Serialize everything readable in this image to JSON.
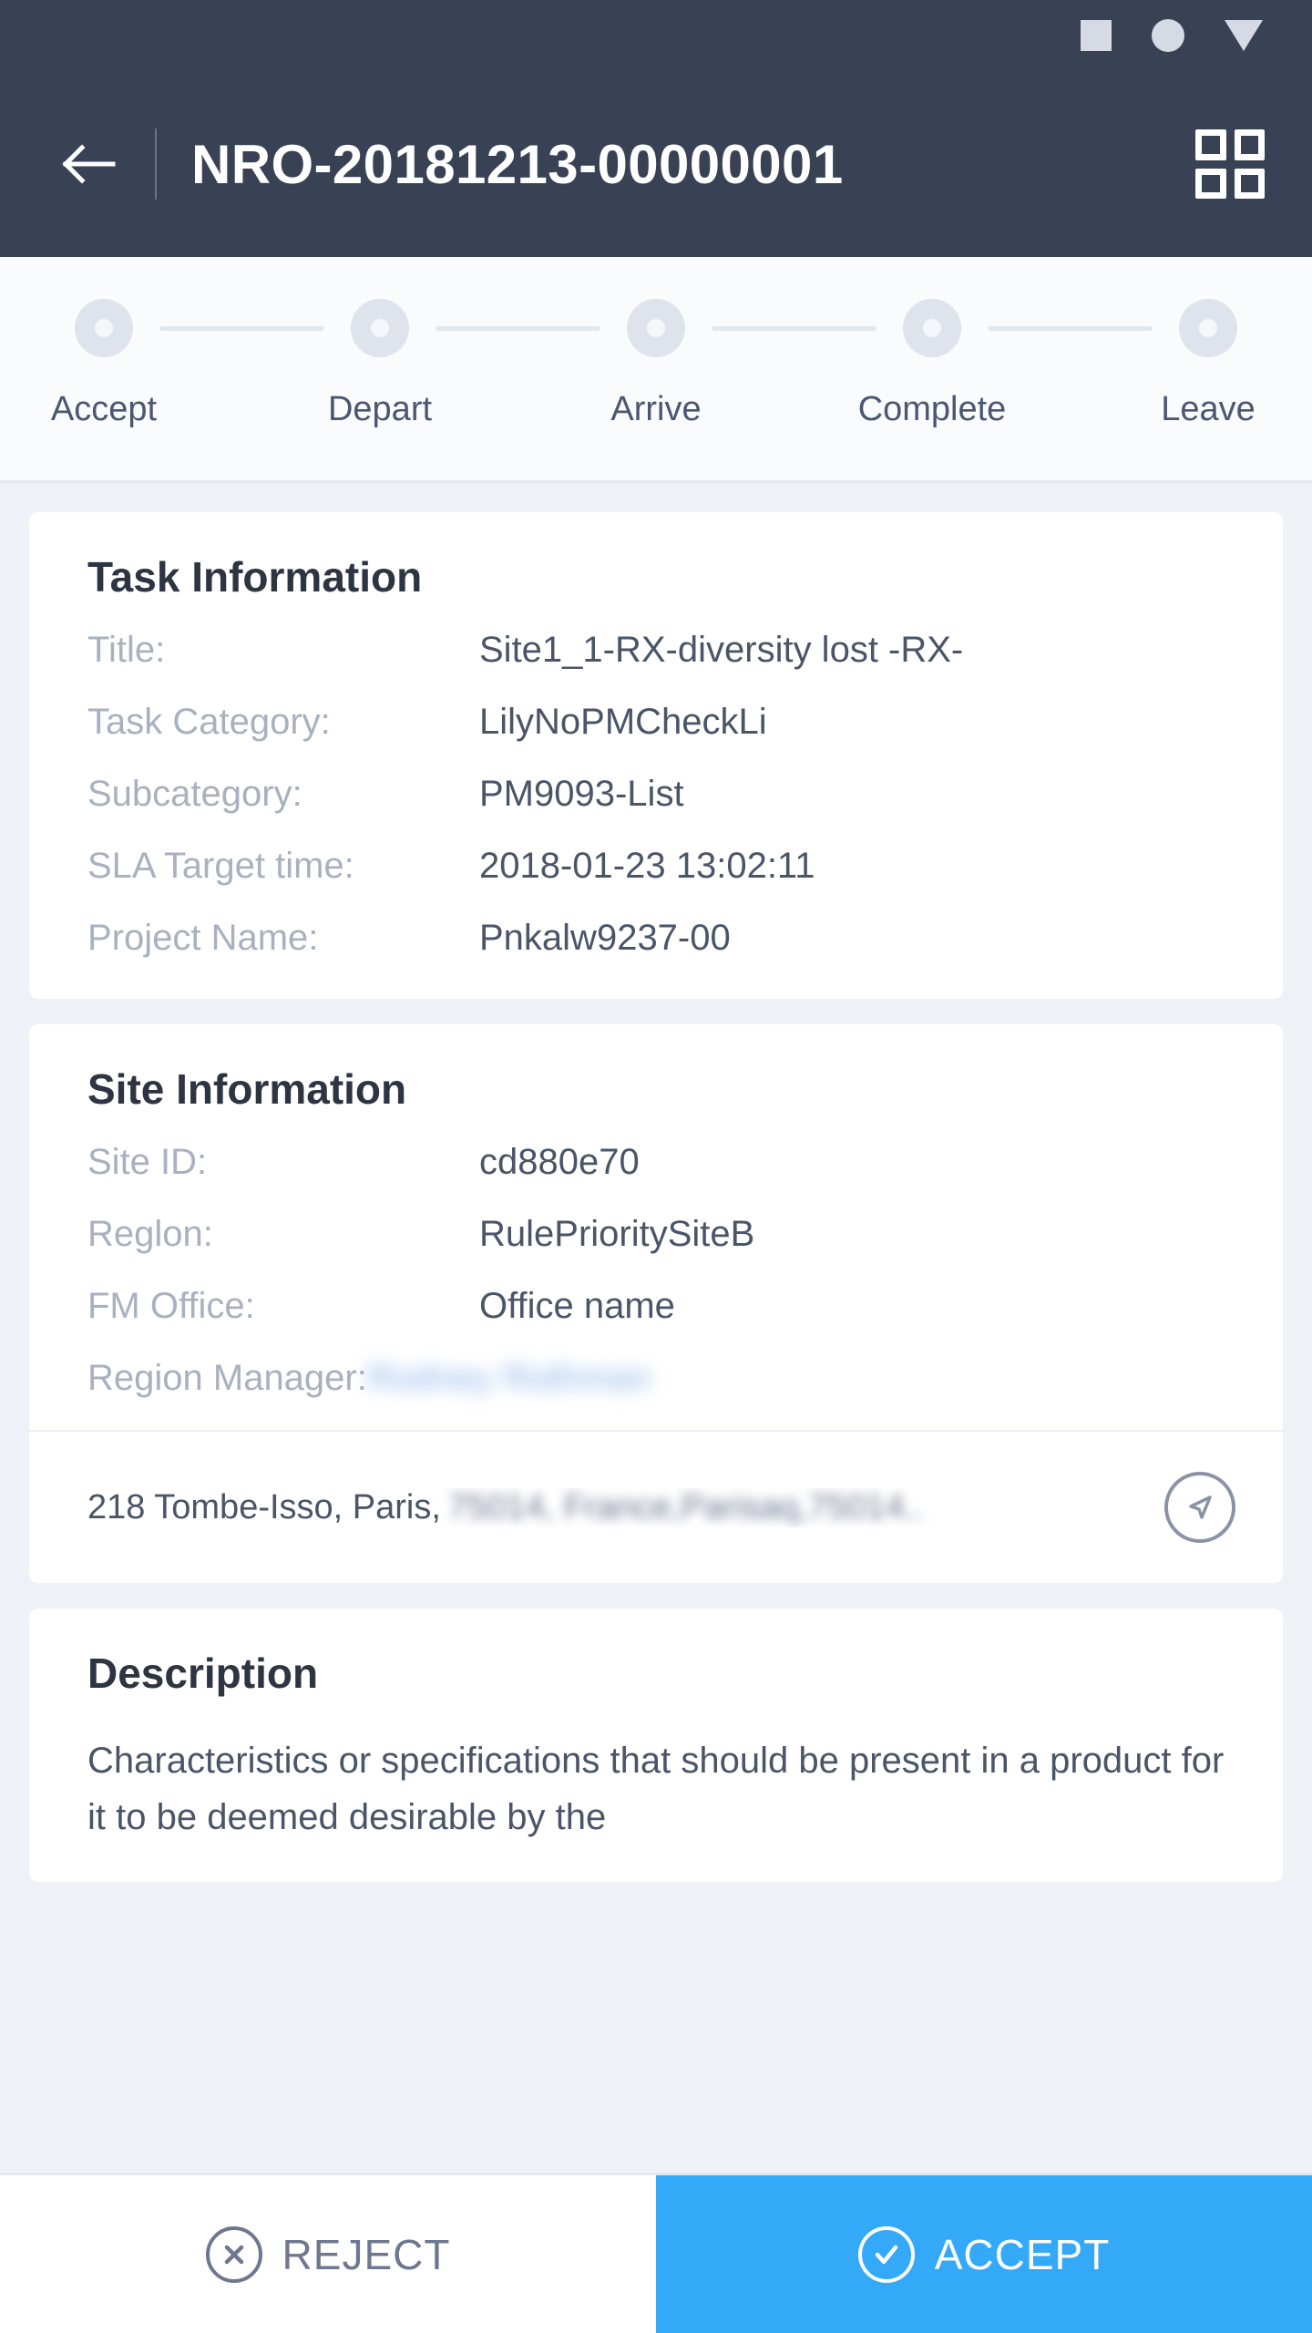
{
  "statusbar": {
    "icons": [
      "square-icon",
      "circle-icon",
      "triangle-down-icon"
    ]
  },
  "appbar": {
    "back_icon": "arrow-left-icon",
    "title": "NRO-20181213-00000001",
    "menu_icon": "grid-menu-icon"
  },
  "stepper": {
    "steps": [
      {
        "label": "Accept"
      },
      {
        "label": "Depart"
      },
      {
        "label": "Arrive"
      },
      {
        "label": "Complete"
      },
      {
        "label": "Leave"
      }
    ]
  },
  "task_card": {
    "title": "Task Information",
    "fields": [
      {
        "label": "Title:",
        "value": "Site1_1-RX-diversity lost -RX-"
      },
      {
        "label": "Task Category:",
        "value": "LilyNoPMCheckLi"
      },
      {
        "label": "Subcategory:",
        "value": "PM9093-List"
      },
      {
        "label": "SLA Target time:",
        "value": "2018-01-23 13:02:11"
      },
      {
        "label": "Project Name:",
        "value": "Pnkalw9237-00"
      }
    ]
  },
  "site_card": {
    "title": "Site Information",
    "fields": [
      {
        "label": "Site ID:",
        "value": "cd880e70"
      },
      {
        "label": "Reglon:",
        "value": "RulePrioritySiteB"
      },
      {
        "label": "FM Office:",
        "value": "Office name"
      }
    ],
    "manager_label": "Region Manager:",
    "manager_value": "Rodney Rothman",
    "address_visible": "218 Tombe-Isso, Paris,",
    "address_redacted": "75014, France,Parisaq,75014..",
    "nav_icon": "navigate-arrow-icon"
  },
  "description_card": {
    "title": "Description",
    "text": "Characteristics or specifications that should be present in a product for it to be deemed desirable by the"
  },
  "actionbar": {
    "reject_label": "REJECT",
    "reject_icon": "circle-x-icon",
    "accept_label": "ACCEPT",
    "accept_icon": "circle-check-icon",
    "accept_color": "#33a9f7"
  }
}
